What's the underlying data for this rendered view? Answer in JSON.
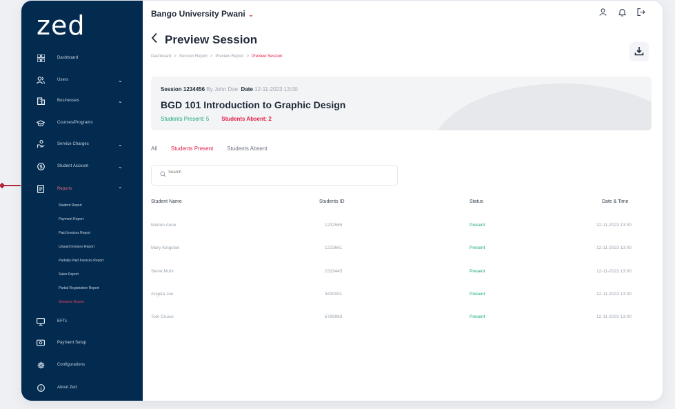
{
  "app": {
    "logo": "zed"
  },
  "sidebar": {
    "items": [
      {
        "label": "Dashboard",
        "icon": "grid-icon",
        "chevron": ""
      },
      {
        "label": "Users",
        "icon": "users-icon",
        "chevron": "⌄"
      },
      {
        "label": "Businesses",
        "icon": "building-icon",
        "chevron": "⌄"
      },
      {
        "label": "Courses/Programs",
        "icon": "book-icon",
        "chevron": ""
      },
      {
        "label": "Service Charges",
        "icon": "hand-coin-icon",
        "chevron": "⌄"
      },
      {
        "label": "Student Account",
        "icon": "dollar-circle-icon",
        "chevron": "⌄"
      },
      {
        "label": "Reports",
        "icon": "report-icon",
        "chevron": "⌃"
      }
    ],
    "subitems": [
      "Student Report",
      "Payment Report",
      "Paid Invoices Report",
      "Unpaid Invoices Report",
      "Partially Paid Invoices Report",
      "Sales Report",
      "Partial Registration Report",
      "Sessions Report"
    ],
    "bottom_items": [
      {
        "label": "EFTs",
        "icon": "monitor-icon"
      },
      {
        "label": "Payment Setup",
        "icon": "cash-icon"
      },
      {
        "label": "Configurations",
        "icon": "gear-icon"
      },
      {
        "label": "About Zed",
        "icon": "info-icon"
      }
    ]
  },
  "header": {
    "university": "Bango University Pwani",
    "caret": "⌄",
    "page_title": "Preview Session",
    "breadcrumb": [
      "Dashboard",
      "Session Report",
      "Preview Report",
      "Preview Session"
    ],
    "breadcrumb_sep": ">"
  },
  "session": {
    "id_label": "Session 1234456",
    "by_label": "By John Doe",
    "date_key": "Date",
    "date_value": "12-11-2023 13:00",
    "course": "BGD 101 Introduction to Graphic Design",
    "present_label": "Students Present: 5",
    "absent_label": "Students Absent: 2"
  },
  "tabs": [
    "All",
    "Students Present",
    "Students Absent"
  ],
  "search": {
    "placeholder": "Search"
  },
  "table": {
    "headers": [
      "Student Name",
      "Students ID",
      "Status",
      "Date & Time"
    ],
    "rows": [
      {
        "name": "Marion Anne",
        "id": "1232565",
        "status": "Present",
        "datetime": "12-11-2023 13:00"
      },
      {
        "name": "Mary Kingston",
        "id": "1223661",
        "status": "Present",
        "datetime": "12-11-2023 13:00"
      },
      {
        "name": "Steve Mohr",
        "id": "1533445",
        "status": "Present",
        "datetime": "12-11-2023 13:00"
      },
      {
        "name": "Angela Joe",
        "id": "3430001",
        "status": "Present",
        "datetime": "12-11-2023 13:00"
      },
      {
        "name": "Tom Cruise",
        "id": "6789983",
        "status": "Present",
        "datetime": "12-11-2023 13:00"
      }
    ]
  },
  "colors": {
    "sidebar": "#032b4f",
    "accent": "#e11d48",
    "present": "#19a974"
  }
}
